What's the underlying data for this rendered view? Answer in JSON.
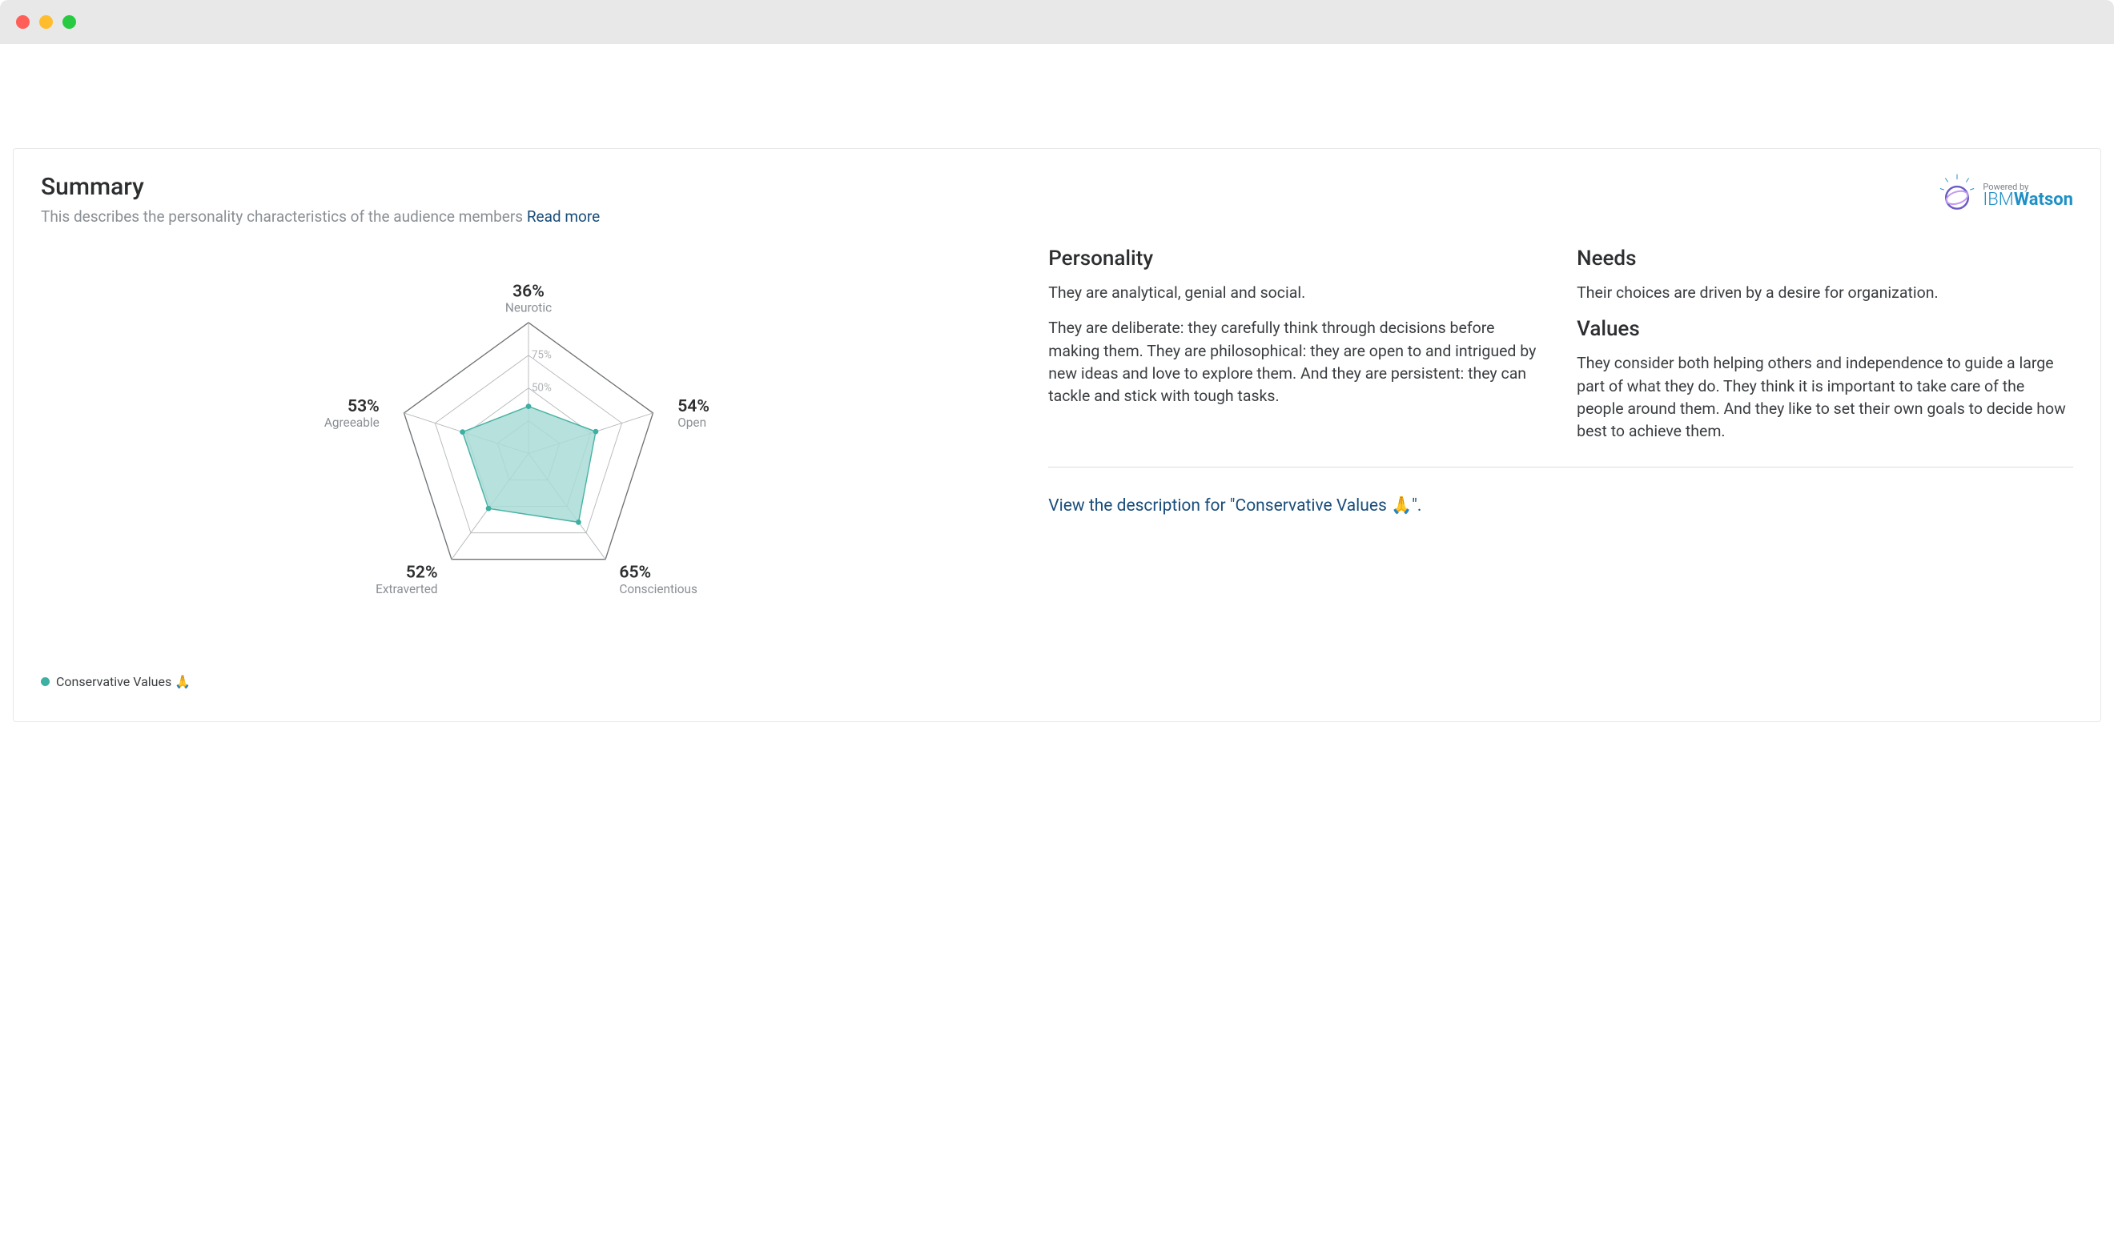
{
  "summary": {
    "title": "Summary",
    "subtitle_prefix": "This describes the personality characteristics of the audience members ",
    "read_more": "Read more"
  },
  "watson": {
    "powered_by": "Powered by",
    "ibm": "IBM",
    "watson": "Watson"
  },
  "personality": {
    "heading": "Personality",
    "p1": "They are analytical, genial and social.",
    "p2": "They are deliberate: they carefully think through decisions before making them. They are philosophical: they are open to and intrigued by new ideas and love to explore them. And they are persistent: they can tackle and stick with tough tasks."
  },
  "needs": {
    "heading": "Needs",
    "p1": "Their choices are driven by a desire for organization."
  },
  "values": {
    "heading": "Values",
    "p1": "They consider both helping others and independence to guide a large part of what they do. They think it is important to take care of the people around them. And they like to set their own goals to decide how best to achieve them."
  },
  "view_link": "View the description for \"Conservative Values 🙏\".",
  "legend_label": "Conservative Values 🙏",
  "chart_data": {
    "type": "radar",
    "max": 100,
    "gridlines": [
      25,
      50,
      75
    ],
    "gridline_labels": {
      "50": "50%",
      "75": "75%"
    },
    "series": [
      {
        "name": "Conservative Values 🙏",
        "color": "#a9dcd6",
        "values": [
          36,
          54,
          65,
          52,
          53
        ]
      }
    ],
    "axes": [
      {
        "label": "Neurotic",
        "value_label": "36%"
      },
      {
        "label": "Open",
        "value_label": "54%"
      },
      {
        "label": "Conscientious",
        "value_label": "65%"
      },
      {
        "label": "Extraverted",
        "value_label": "52%"
      },
      {
        "label": "Agreeable",
        "value_label": "53%"
      }
    ]
  }
}
